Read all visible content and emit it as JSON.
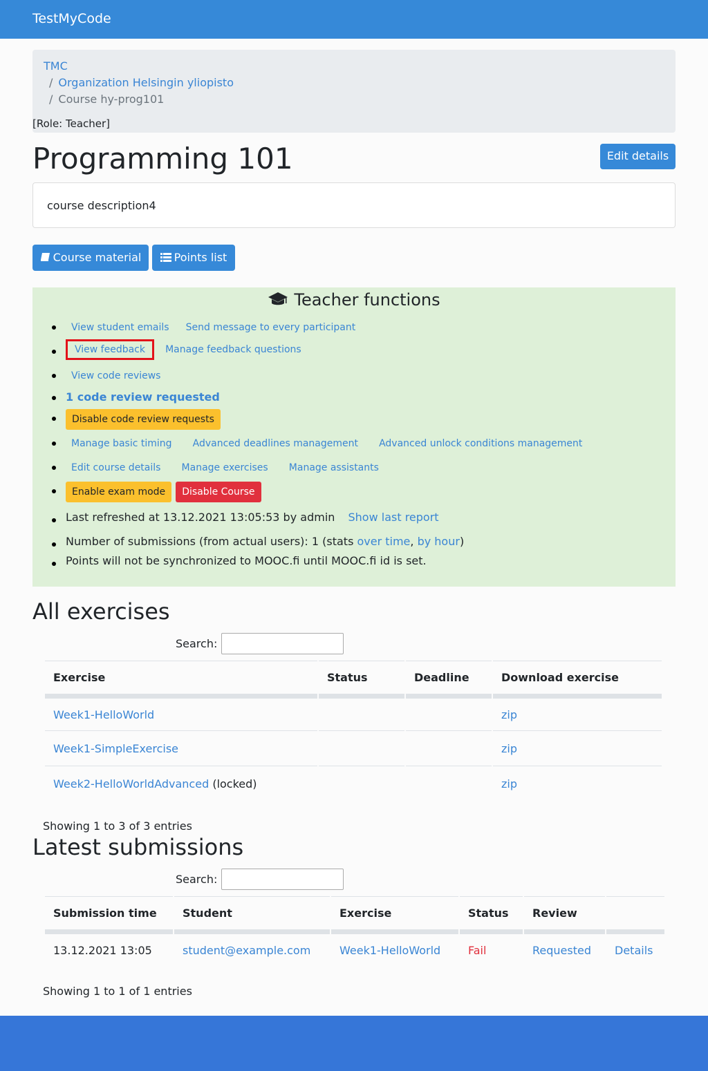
{
  "brand": "TestMyCode",
  "breadcrumb": {
    "items": [
      "TMC",
      "Organization Helsingin yliopisto",
      "Course hy-prog101"
    ],
    "separator": "/",
    "role": "[Role: Teacher]"
  },
  "course": {
    "title": "Programming 101",
    "edit_label": "Edit details",
    "description": "course description4",
    "material_label": "Course material",
    "points_label": "Points list"
  },
  "teacher": {
    "heading": "Teacher functions",
    "view_student_emails": "View student emails",
    "send_message": "Send message to every participant",
    "view_feedback": "View feedback",
    "manage_feedback_questions": "Manage feedback questions",
    "view_code_reviews": "View code reviews",
    "code_review_requested": "1 code review requested",
    "disable_code_review_requests": "Disable code review requests",
    "manage_basic_timing": "Manage basic timing",
    "advanced_deadlines": "Advanced deadlines management",
    "advanced_unlock": "Advanced unlock conditions management",
    "edit_course_details": "Edit course details",
    "manage_exercises": "Manage exercises",
    "manage_assistants": "Manage assistants",
    "enable_exam_mode": "Enable exam mode",
    "disable_course": "Disable Course",
    "last_refreshed": "Last refreshed at 13.12.2021 13:05:53 by admin",
    "show_last_report": "Show last report",
    "submissions_prefix": "Number of submissions (from actual users): 1 (stats ",
    "over_time": "over time",
    "comma": ", ",
    "by_hour": "by hour",
    "close_paren": ")",
    "mooc_note": "Points will not be synchronized to MOOC.fi until MOOC.fi id is set."
  },
  "exercises": {
    "heading": "All exercises",
    "search_label": "Search:",
    "headers": [
      "Exercise",
      "Status",
      "Deadline",
      "Download exercise"
    ],
    "rows": [
      {
        "name": "Week1-HelloWorld",
        "suffix": "",
        "status": "",
        "deadline": "",
        "download": "zip"
      },
      {
        "name": "Week1-SimpleExercise",
        "suffix": "",
        "status": "",
        "deadline": "",
        "download": "zip"
      },
      {
        "name": "Week2-HelloWorldAdvanced",
        "suffix": " (locked)",
        "status": "",
        "deadline": "",
        "download": "zip"
      }
    ],
    "showing": "Showing 1 to 3 of 3 entries"
  },
  "submissions": {
    "heading": "Latest submissions",
    "search_label": "Search:",
    "headers": [
      "Submission time",
      "Student",
      "Exercise",
      "Status",
      "Review",
      ""
    ],
    "rows": [
      {
        "time": "13.12.2021 13:05",
        "student": "student@example.com",
        "exercise": "Week1-HelloWorld",
        "status": "Fail",
        "review": "Requested",
        "details": "Details"
      }
    ],
    "showing": "Showing 1 to 1 of 1 entries"
  },
  "colors": {
    "navbar": "#3689d8",
    "teacher_panel": "#def0d8",
    "warning": "#fbc02d",
    "danger": "#e1303d",
    "highlight": "#e3131a",
    "footer": "#3676d8"
  }
}
